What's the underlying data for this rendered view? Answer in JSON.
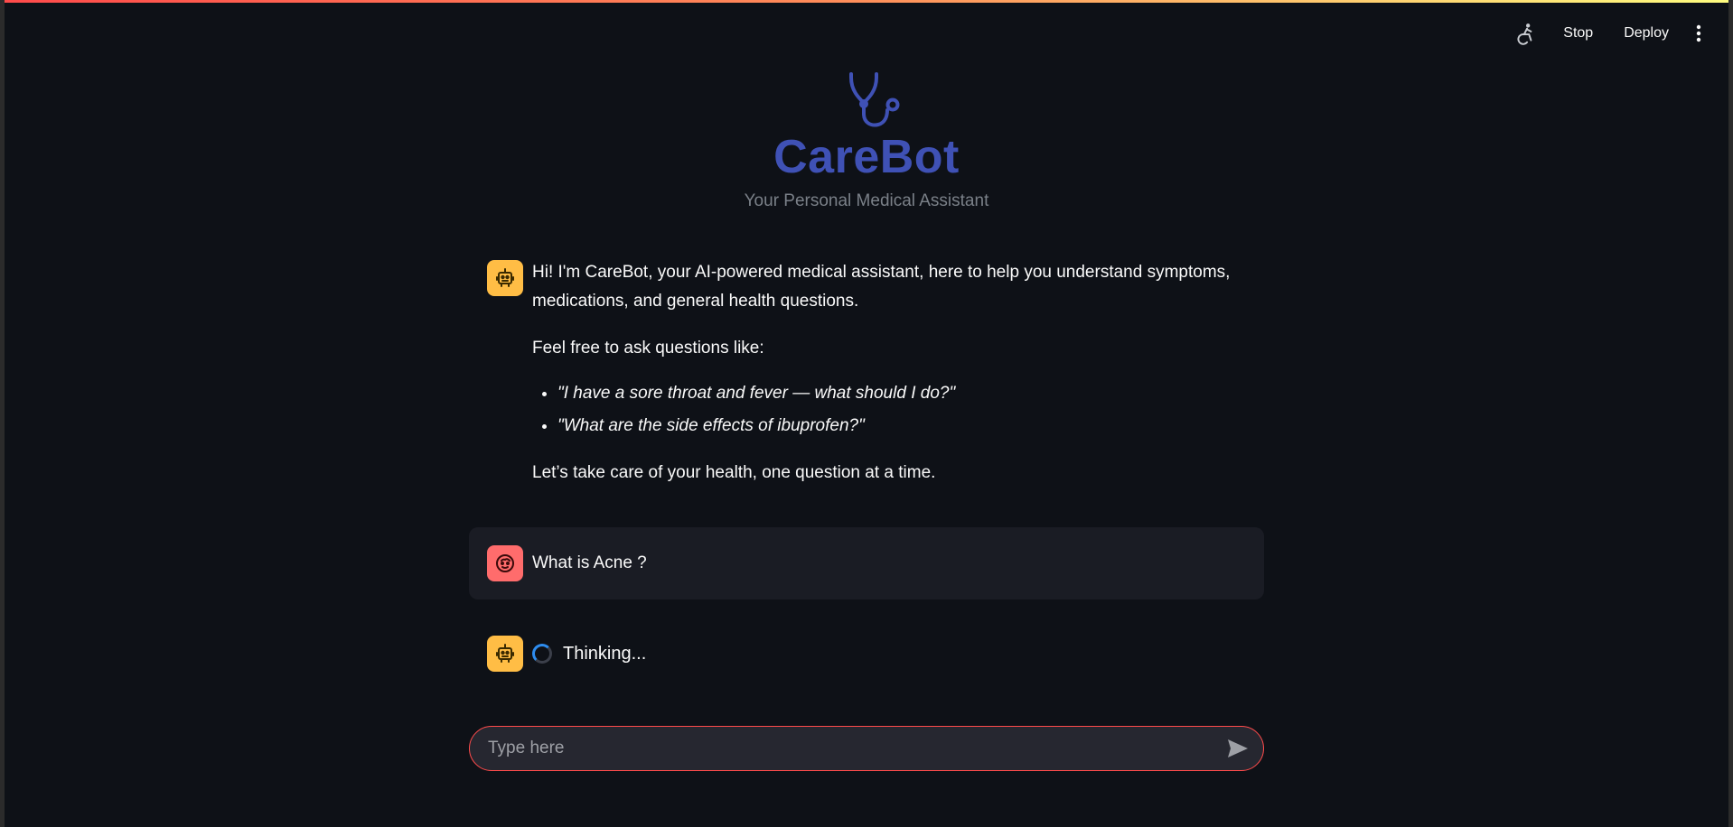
{
  "toolbar": {
    "stop_label": "Stop",
    "deploy_label": "Deploy"
  },
  "hero": {
    "title": "CareBot",
    "subtitle": "Your Personal Medical Assistant"
  },
  "messages": {
    "welcome": {
      "intro": "Hi! I'm CareBot, your AI-powered medical assistant, here to help you understand symptoms, medications, and general health questions.",
      "prompt": "Feel free to ask questions like:",
      "examples": [
        "\"I have a sore throat and fever — what should I do?\"",
        "\"What are the side effects of ibuprofen?\""
      ],
      "closing": "Let’s take care of your health, one question at a time."
    },
    "user_question": "What is Acne ?",
    "thinking_label": "Thinking..."
  },
  "input": {
    "placeholder": "Type here",
    "value": ""
  },
  "colors": {
    "background": "#0e1117",
    "brand": "#3f51b5",
    "bot_avatar": "#ffbd45",
    "user_avatar": "#ff6c6c",
    "input_border": "#ff4b4b"
  },
  "icons": {
    "toolbar_status": "running-figure-icon",
    "menu": "vertical-dots-icon",
    "hero": "stethoscope-icon",
    "bot_avatar": "robot-face-icon",
    "user_avatar": "user-face-icon",
    "send": "send-arrow-icon"
  }
}
